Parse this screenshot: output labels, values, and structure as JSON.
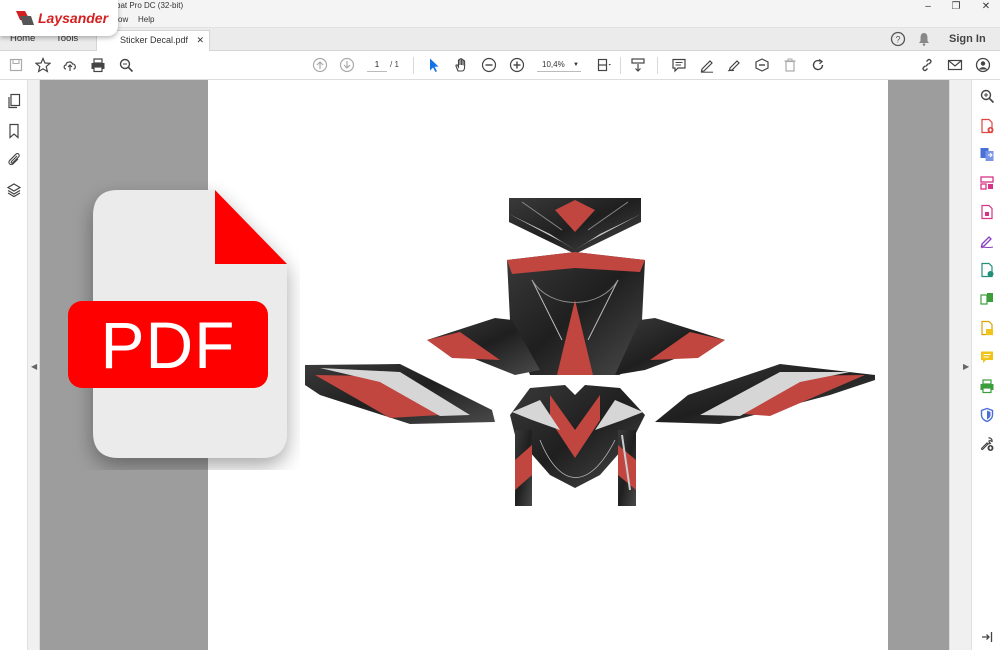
{
  "logo": {
    "name": "Laysander"
  },
  "window": {
    "title": "bat Pro DC (32-bit)",
    "controls": {
      "minimize": "–",
      "maximize": "❐",
      "close": "✕"
    }
  },
  "menu": {
    "items": [
      "ow",
      "Help"
    ]
  },
  "tabs": {
    "home": "Home",
    "tools": "Tools",
    "document": "Sticker Decal.pdf",
    "close": "✕",
    "help": "?",
    "sign_in": "Sign In"
  },
  "toolbar": {
    "page_current": "1",
    "page_total": "/ 1",
    "zoom": "10,4%"
  },
  "badge": {
    "label": "PDF"
  },
  "colors": {
    "accent": "#1473e6",
    "pdf_red": "#fe0000",
    "decal_red": "#c0463f",
    "decal_dark": "#2b2b2b"
  },
  "right_tools_icons": [
    "create-pdf-icon",
    "export-pdf-icon",
    "organize-pages-icon",
    "compress-icon",
    "fill-sign-icon",
    "edit-pdf-icon",
    "combine-icon",
    "send-for-review-icon",
    "comment-icon",
    "print-production-icon",
    "protect-icon",
    "more-tools-icon"
  ]
}
